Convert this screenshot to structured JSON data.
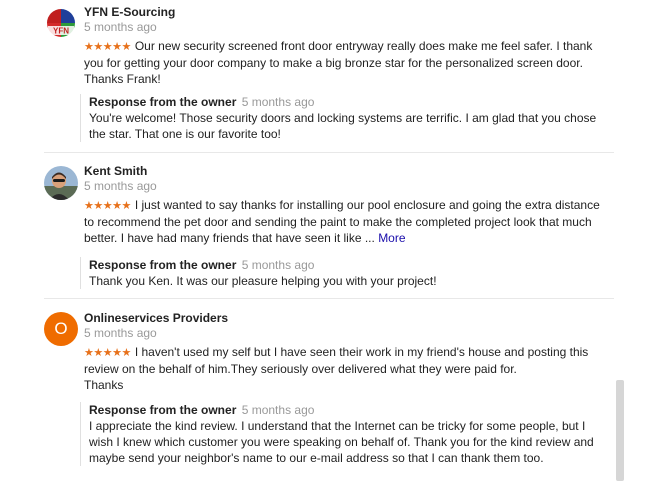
{
  "reviews": [
    {
      "name": "YFN E-Sourcing",
      "time": "5 months ago",
      "stars": "★★★★★",
      "text": "Our new security screened front door entryway really does make me feel safer. I thank you for getting your door company to make a big bronze star for the personalized screen door. Thanks Frank!",
      "avatar_label": "YFN",
      "response": {
        "title": "Response from the owner",
        "time": "5 months ago",
        "text": "You're welcome! Those security doors and locking systems are terrific. I am glad that you chose the star. That one is our favorite too!"
      }
    },
    {
      "name": "Kent Smith",
      "time": "5 months ago",
      "stars": "★★★★★",
      "text": "I just wanted to say thanks for installing our pool enclosure and going the extra distance to recommend the pet door and sending the paint to make the completed project look that much better. I have had many friends that have seen it like ...",
      "more": "More",
      "response": {
        "title": "Response from the owner",
        "time": "5 months ago",
        "text": "Thank you Ken. It was our pleasure helping you with your project!"
      }
    },
    {
      "name": "Onlineservices Providers",
      "time": "5 months ago",
      "stars": "★★★★★",
      "text": "I haven't used my self but I have seen their work in my friend's house and posting this review on the behalf of him.They seriously over delivered what they were paid for.",
      "text2": "Thanks",
      "avatar_letter": "O",
      "avatar_color": "#ef6c00",
      "response": {
        "title": "Response from the owner",
        "time": "5 months ago",
        "text": "I appreciate the kind review. I understand that the Internet can be tricky for some people, but I wish I knew which customer you were speaking on behalf of. Thank you for the kind review and maybe send your neighbor's name to our e-mail address so that I can thank them too."
      }
    }
  ],
  "colors": {
    "star": "#e7711b",
    "link": "#1a0dab",
    "muted": "#999999"
  }
}
